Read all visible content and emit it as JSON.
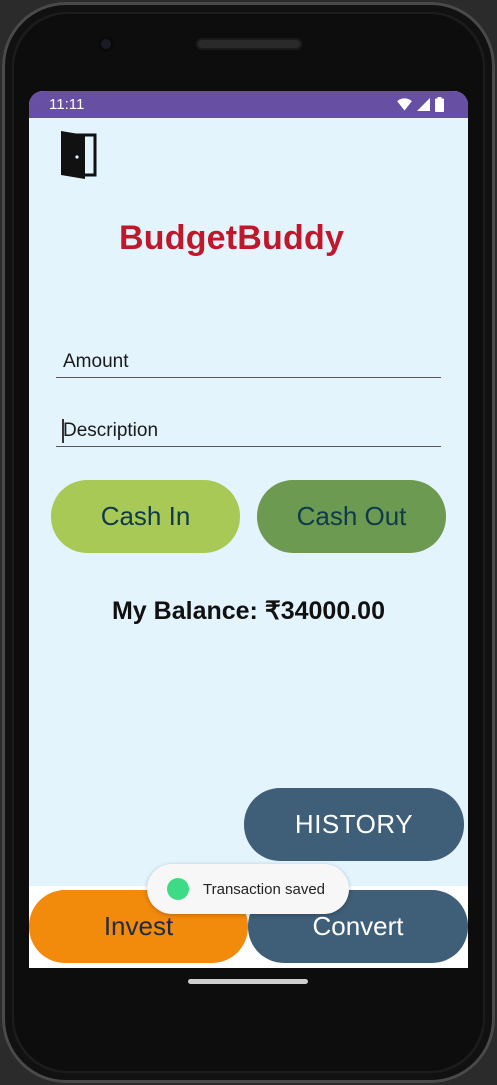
{
  "status": {
    "time": "11:11"
  },
  "app": {
    "title": "BudgetBuddy"
  },
  "form": {
    "amount_placeholder": "Amount",
    "description_placeholder": "Description"
  },
  "buttons": {
    "cash_in": "Cash In",
    "cash_out": "Cash Out",
    "history": "HISTORY",
    "invest": "Invest",
    "convert": "Convert"
  },
  "balance": {
    "text": "My Balance: ₹34000.00"
  },
  "toast": {
    "message": "Transaction saved"
  },
  "icons": {
    "logout": "door-exit-icon",
    "wifi": "wifi-icon",
    "signal": "signal-icon",
    "battery": "battery-icon",
    "toast": "android-icon"
  },
  "colors": {
    "status_bar": "#6750a4",
    "background": "#e3f4fd",
    "title": "#c0182a",
    "cash_in": "#a9c957",
    "cash_out": "#6c9a51",
    "history": "#3f5e78",
    "invest": "#f28a0b",
    "convert": "#3f5e78"
  }
}
